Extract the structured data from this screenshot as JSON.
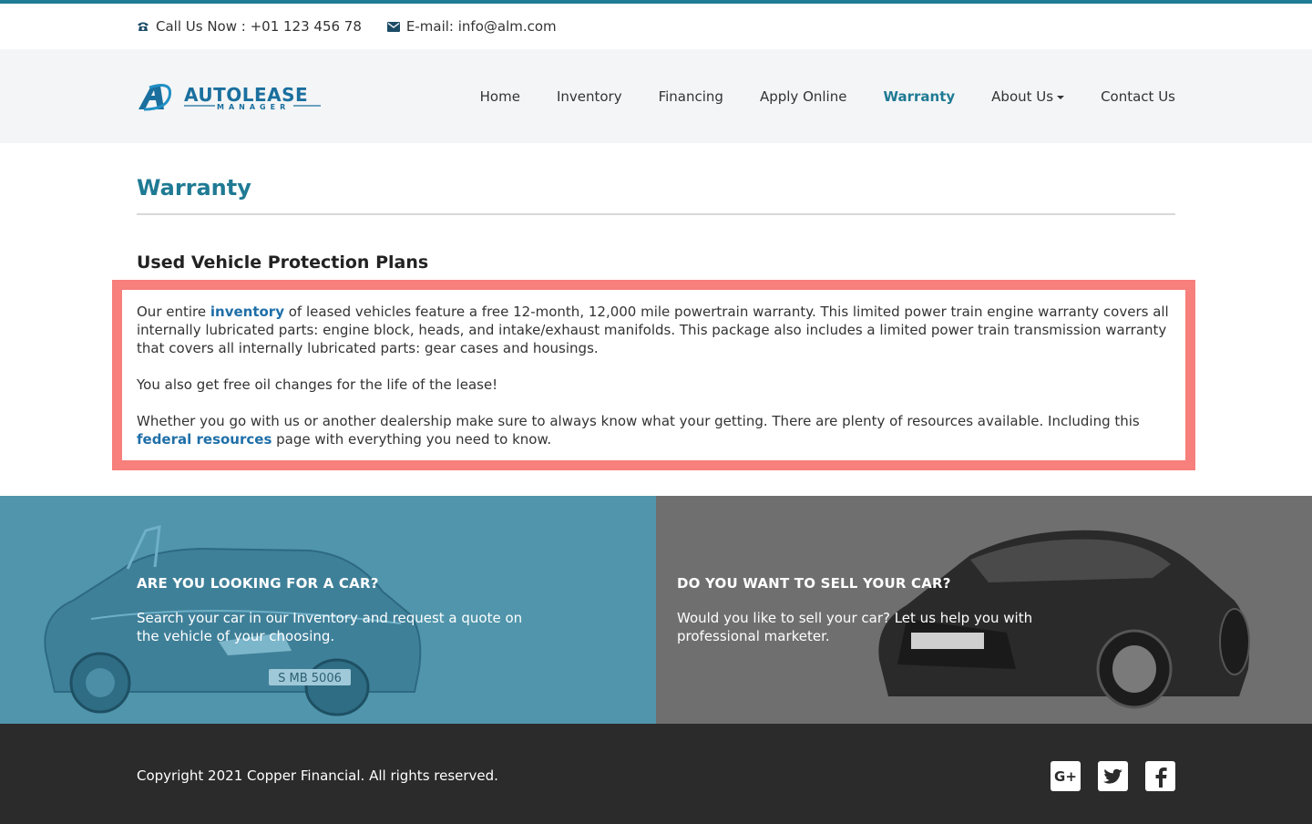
{
  "topbar": {
    "phone": "Call Us Now : +01 123 456 78",
    "email": "E-mail: info@alm.com",
    "phone_icon": "phone-icon",
    "email_icon": "envelope-icon"
  },
  "logo": {
    "name": "AUTOLEASE",
    "sub": "MANAGER"
  },
  "nav": {
    "items": [
      {
        "label": "Home"
      },
      {
        "label": "Inventory"
      },
      {
        "label": "Financing"
      },
      {
        "label": "Apply Online"
      },
      {
        "label": "Warranty",
        "active": true
      },
      {
        "label": "About Us",
        "dropdown": true
      },
      {
        "label": "Contact Us"
      }
    ]
  },
  "main": {
    "title": "Warranty",
    "subtitle": "Used Vehicle Protection Plans",
    "p1_before": "Our entire ",
    "p1_link": "inventory",
    "p1_after": " of leased vehicles feature a free 12-month, 12,000 mile powertrain warranty. This limited power train engine warranty covers all internally lubricated parts: engine block, heads, and intake/exhaust manifolds. This package also includes a limited power train transmission warranty that covers all internally lubricated parts: gear cases and housings.",
    "p2": "You also get free oil changes for the life of the lease!",
    "p3_before": "Whether you go with us or another dealership make sure to always know what your getting. There are plenty of resources available. Including this ",
    "p3_link": "federal resources",
    "p3_after": " page with everything you need to know."
  },
  "promo": {
    "left": {
      "title": "ARE YOU LOOKING FOR A CAR?",
      "text": "Search your car in our Inventory and request a quote on the vehicle of your choosing.",
      "plate": "S MB 5006"
    },
    "right": {
      "title": "DO YOU WANT TO SELL YOUR CAR?",
      "text": "Would you like to sell your car? Let us help you with professional marketer."
    }
  },
  "footer": {
    "copyright": "Copyright 2021 Copper Financial. All rights reserved.",
    "social": [
      "google-plus-icon",
      "twitter-icon",
      "facebook-icon"
    ],
    "gplus_label": "G+"
  },
  "colors": {
    "accent": "#1f7a94",
    "link": "#1f6fa8",
    "highlight_border": "#f77f7c",
    "promo_left": "#5095ab",
    "promo_right": "#6f6f6f",
    "footer": "#2b2b2b"
  }
}
